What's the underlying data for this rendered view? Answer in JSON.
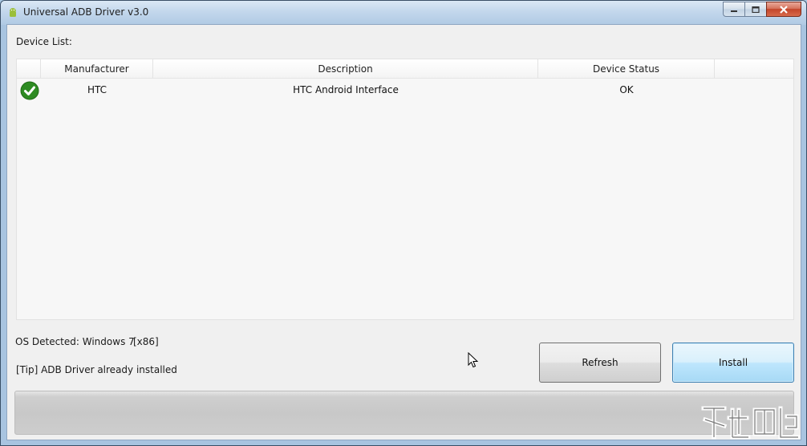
{
  "window": {
    "title": "Universal ADB Driver v3.0",
    "icon": "android-icon",
    "controls": {
      "minimize": "minimize-icon",
      "maximize": "maximize-icon",
      "close": "close-icon"
    }
  },
  "device_list": {
    "label": "Device List:",
    "columns": [
      "Manufacturer",
      "Description",
      "Device Status"
    ],
    "rows": [
      {
        "status_icon": "check-circle-icon",
        "manufacturer": "HTC",
        "description": "HTC Android Interface",
        "status": "OK"
      }
    ]
  },
  "os_info": {
    "detected": "OS Detected: Windows 7",
    "arch": "[x86]"
  },
  "tip": "[Tip] ADB Driver already installed",
  "buttons": {
    "refresh": "Refresh",
    "install": "Install"
  },
  "progress": {
    "fraction": 0
  },
  "colors": {
    "check": "#2e8b22",
    "install_border": "#3c7fb1",
    "close_button": "#c3452a"
  }
}
